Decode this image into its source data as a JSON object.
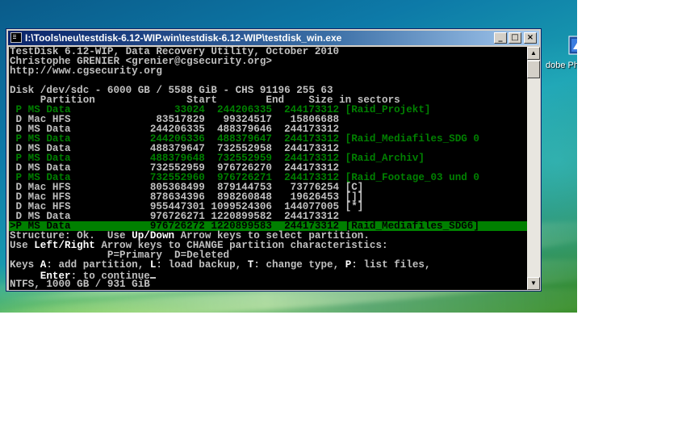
{
  "window": {
    "title": "I:\\Tools\\neu\\testdisk-6.12-WIP.win\\testdisk-6.12-WIP\\testdisk_win.exe",
    "buttons": {
      "minimize": "_",
      "maximize": "□",
      "close": "×"
    }
  },
  "desktop": {
    "icon_label": "dobe Ph"
  },
  "console": {
    "header": [
      "TestDisk 6.12-WIP, Data Recovery Utility, October 2010",
      "Christophe GRENIER <grenier@cgsecurity.org>",
      "http://www.cgsecurity.org"
    ],
    "disk_info": "Disk /dev/sdc - 6000 GB / 5588 GiB - CHS 91196 255 63",
    "columns": "     Partition               Start        End    Size in sectors",
    "rows": [
      {
        "text": " P MS Data                 33024  244206335  244173312 [Raid_Projekt]",
        "style": "green"
      },
      {
        "text": " D Mac HFS              83517829   99324517   15806688",
        "style": "normal"
      },
      {
        "text": " D MS Data             244206335  488379646  244173312",
        "style": "normal"
      },
      {
        "text": " P MS Data             244206336  488379647  244173312 [Raid_Mediafiles_SDG 0",
        "style": "green"
      },
      {
        "text": " D MS Data             488379647  732552958  244173312",
        "style": "normal"
      },
      {
        "text": " P MS Data             488379648  732552959  244173312 [Raid_Archiv]",
        "style": "green"
      },
      {
        "text": " D MS Data             732552959  976726270  244173312",
        "style": "normal"
      },
      {
        "text": " P MS Data             732552960  976726271  244173312 [Raid_Footage_03 und 0",
        "style": "green"
      },
      {
        "text": " D Mac HFS             805368499  879144753   73776254 [C]",
        "style": "normal"
      },
      {
        "text": " D Mac HFS             878634396  898260848   19626453 []]",
        "style": "normal"
      },
      {
        "text": " D Mac HFS             955447301 1099524306  144077005 [*]",
        "style": "normal"
      },
      {
        "text": " D MS Data             976726271 1220899582  244173312",
        "style": "normal"
      },
      {
        "text": ">P MS Data             976726272 1220899583  244173312 [Raid_Mediafiles_SDG6]",
        "style": "selected"
      }
    ],
    "help": {
      "structure_a": "Structure: Ok.  Use ",
      "structure_key": "Up/Down",
      "structure_b": " Arrow keys to select partition.",
      "use_a": "Use ",
      "use_key": "Left/Right",
      "use_b": " Arrow keys to CHANGE partition characteristics:",
      "legend": "                P=Primary  D=Deleted",
      "keys_label": "Keys ",
      "key_a": "A",
      "keys_a_text": ": add partition, ",
      "key_l": "L",
      "keys_l_text": ": load backup, ",
      "key_t": "T",
      "keys_t_text": ": change type, ",
      "key_p": "P",
      "keys_p_text": ": list files,",
      "enter_indent": "     ",
      "enter_key": "Enter",
      "enter_text": ": to continue",
      "status": "NTFS, 1000 GB / 931 GiB"
    }
  },
  "colors": {
    "console_bg": "#000000",
    "console_text": "#c0c0c0",
    "primary_partition": "#008000",
    "selected_bg": "#008000",
    "titlebar": "#0a246a"
  }
}
